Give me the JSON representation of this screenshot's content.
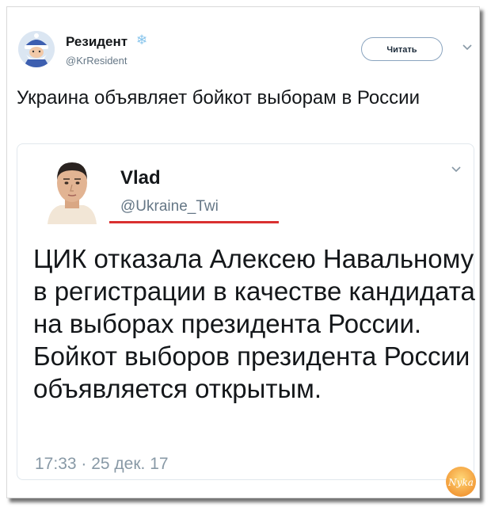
{
  "tweet": {
    "author_name": "Резидент",
    "author_handle": "@KrResident",
    "follow_label": "Читать",
    "text": "Украина объявляет бойкот выборам в России"
  },
  "quoted_tweet": {
    "author_name": "Vlad",
    "author_handle": "@Ukraine_Twi",
    "text": "ЦИК отказала Алексею Навальному в регистрации в качестве кандидата на выборах президента России. Бойкот выборов президента России объявляется открытым.",
    "timestamp": "17:33 · 25 дек. 17"
  },
  "watermark": {
    "text": "Nyka"
  },
  "colors": {
    "text": "#14171a",
    "secondary": "#657786",
    "underline": "#d93030",
    "snowflake": "#86c4ec"
  }
}
